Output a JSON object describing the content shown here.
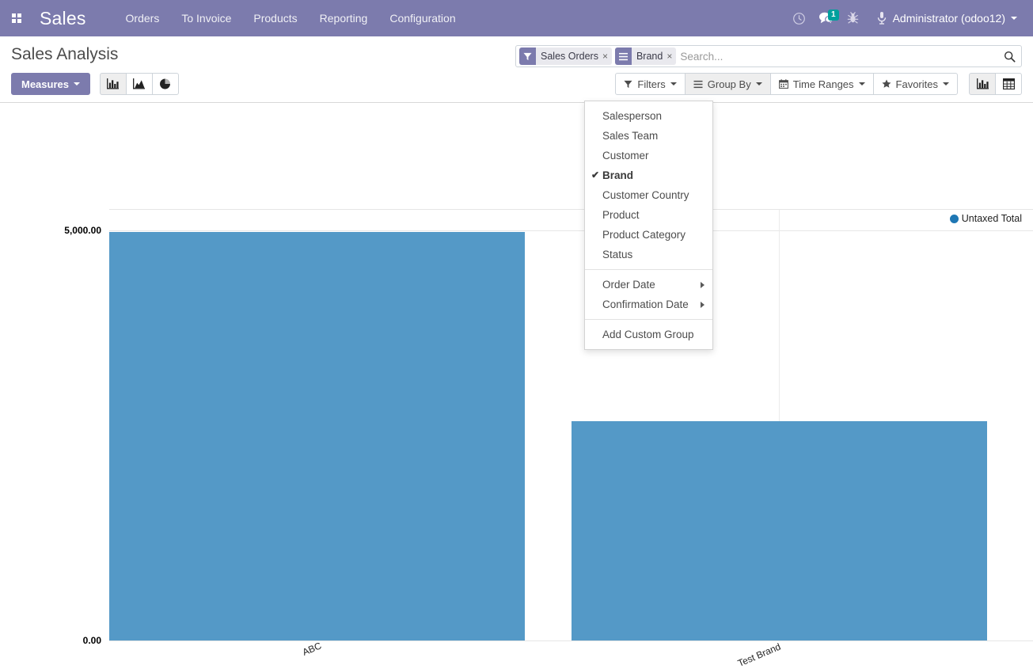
{
  "navbar": {
    "apps_icon": "apps-grid-icon",
    "brand": "Sales",
    "menu": [
      {
        "label": "Orders"
      },
      {
        "label": "To Invoice"
      },
      {
        "label": "Products"
      },
      {
        "label": "Reporting"
      },
      {
        "label": "Configuration"
      }
    ],
    "activity_icon": "clock-icon",
    "messages_icon": "chat-bubble-icon",
    "messages_count": "1",
    "debug_icon": "bug-icon",
    "user_icon": "user-avatar-icon",
    "user_name": "Administrator (odoo12)"
  },
  "control_panel": {
    "title": "Sales Analysis",
    "measures_label": "Measures",
    "chart_type_buttons": [
      {
        "name": "bar-chart-icon",
        "active": true
      },
      {
        "name": "line-chart-icon",
        "active": false
      },
      {
        "name": "pie-chart-icon",
        "active": false
      }
    ],
    "filters_label": "Filters",
    "group_by_label": "Group By",
    "time_ranges_label": "Time Ranges",
    "favorites_label": "Favorites",
    "view_switcher": [
      {
        "name": "graph-view-icon",
        "active": true
      },
      {
        "name": "pivot-view-icon",
        "active": false
      }
    ]
  },
  "search": {
    "placeholder": "Search...",
    "search_icon": "magnifier-icon",
    "facets": [
      {
        "icon": "filter-funnel-icon",
        "label": "Sales Orders",
        "remove": "×"
      },
      {
        "icon": "group-by-bars-icon",
        "label": "Brand",
        "remove": "×"
      }
    ]
  },
  "group_by_menu": {
    "items": [
      {
        "label": "Salesperson",
        "checked": false,
        "submenu": false
      },
      {
        "label": "Sales Team",
        "checked": false,
        "submenu": false
      },
      {
        "label": "Customer",
        "checked": false,
        "submenu": false
      },
      {
        "label": "Brand",
        "checked": true,
        "submenu": false
      },
      {
        "label": "Customer Country",
        "checked": false,
        "submenu": false
      },
      {
        "label": "Product",
        "checked": false,
        "submenu": false
      },
      {
        "label": "Product Category",
        "checked": false,
        "submenu": false
      },
      {
        "label": "Status",
        "checked": false,
        "submenu": false
      }
    ],
    "date_items": [
      {
        "label": "Order Date",
        "submenu": true
      },
      {
        "label": "Confirmation Date",
        "submenu": true
      }
    ],
    "custom_label": "Add Custom Group",
    "check_glyph": "✔"
  },
  "chart_data": {
    "type": "bar",
    "title": "Sales Analysis",
    "categories": [
      "ABC",
      "Test Brand"
    ],
    "series": [
      {
        "name": "Untaxed Total",
        "color": "#5499c7",
        "values": [
          5000.0,
          2680.0
        ]
      }
    ],
    "legend": [
      {
        "label": "Untaxed Total",
        "color": "#1f77b4"
      }
    ],
    "legend_position": "top-right",
    "xlabel": "",
    "ylabel": "",
    "ylim": [
      0,
      5000
    ],
    "yticks": [
      "0.00",
      "5,000.00"
    ],
    "ytick_values": [
      0,
      5000
    ],
    "grid": true
  },
  "colors": {
    "brand_purple": "#7c7bad",
    "bar_blue": "#5499c7",
    "legend_blue": "#1f77b4",
    "badge_teal": "#00A09D"
  }
}
